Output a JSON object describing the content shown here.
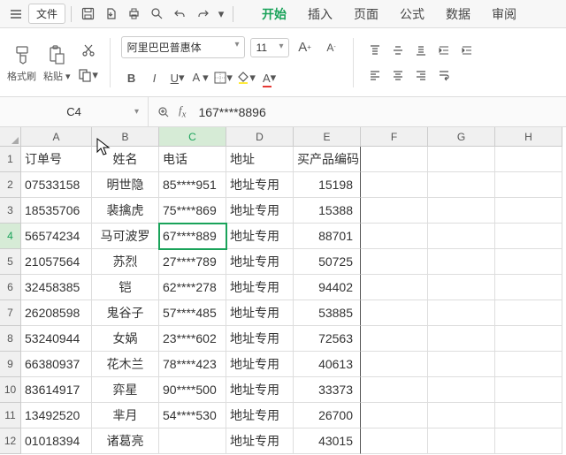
{
  "menu": {
    "file": "文件",
    "tabs": [
      "开始",
      "插入",
      "页面",
      "公式",
      "数据",
      "审阅"
    ],
    "active_tab_index": 0
  },
  "ribbon": {
    "format_painter": "格式刷",
    "paste": "粘贴",
    "font_name": "阿里巴巴普惠体",
    "font_size": "11"
  },
  "formula": {
    "name_box": "C4",
    "value": "167****8896"
  },
  "columns": [
    "A",
    "B",
    "C",
    "D",
    "E",
    "F",
    "G",
    "H"
  ],
  "active_col_index": 2,
  "active_row_index": 4,
  "headers": [
    "订单号",
    "姓名",
    "电话",
    "地址",
    "买产品编码"
  ],
  "rows": [
    {
      "n": 1,
      "a": "订单号",
      "b": "姓名",
      "c": "电话",
      "d": "地址",
      "e": "买产品编码"
    },
    {
      "n": 2,
      "a": "07533158",
      "b": "明世隐",
      "c": "85****951",
      "d": "地址专用",
      "e": "15198"
    },
    {
      "n": 3,
      "a": "18535706",
      "b": "裴擒虎",
      "c": "75****869",
      "d": "地址专用",
      "e": "15388"
    },
    {
      "n": 4,
      "a": "56574234",
      "b": "马可波罗",
      "c": "67****889",
      "d": "地址专用",
      "e": "88701"
    },
    {
      "n": 5,
      "a": "21057564",
      "b": "苏烈",
      "c": "27****789",
      "d": "地址专用",
      "e": "50725"
    },
    {
      "n": 6,
      "a": "32458385",
      "b": "铠",
      "c": "62****278",
      "d": "地址专用",
      "e": "94402"
    },
    {
      "n": 7,
      "a": "26208598",
      "b": "鬼谷子",
      "c": "57****485",
      "d": "地址专用",
      "e": "53885"
    },
    {
      "n": 8,
      "a": "53240944",
      "b": "女娲",
      "c": "23****602",
      "d": "地址专用",
      "e": "72563"
    },
    {
      "n": 9,
      "a": "66380937",
      "b": "花木兰",
      "c": "78****423",
      "d": "地址专用",
      "e": "40613"
    },
    {
      "n": 10,
      "a": "83614917",
      "b": "弈星",
      "c": "90****500",
      "d": "地址专用",
      "e": "33373"
    },
    {
      "n": 11,
      "a": "13492520",
      "b": "芈月",
      "c": "54****530",
      "d": "地址专用",
      "e": "26700"
    },
    {
      "n": 12,
      "a": "01018394",
      "b": "诸葛亮",
      "c": "",
      "d": "地址专用",
      "e": "43015"
    }
  ]
}
